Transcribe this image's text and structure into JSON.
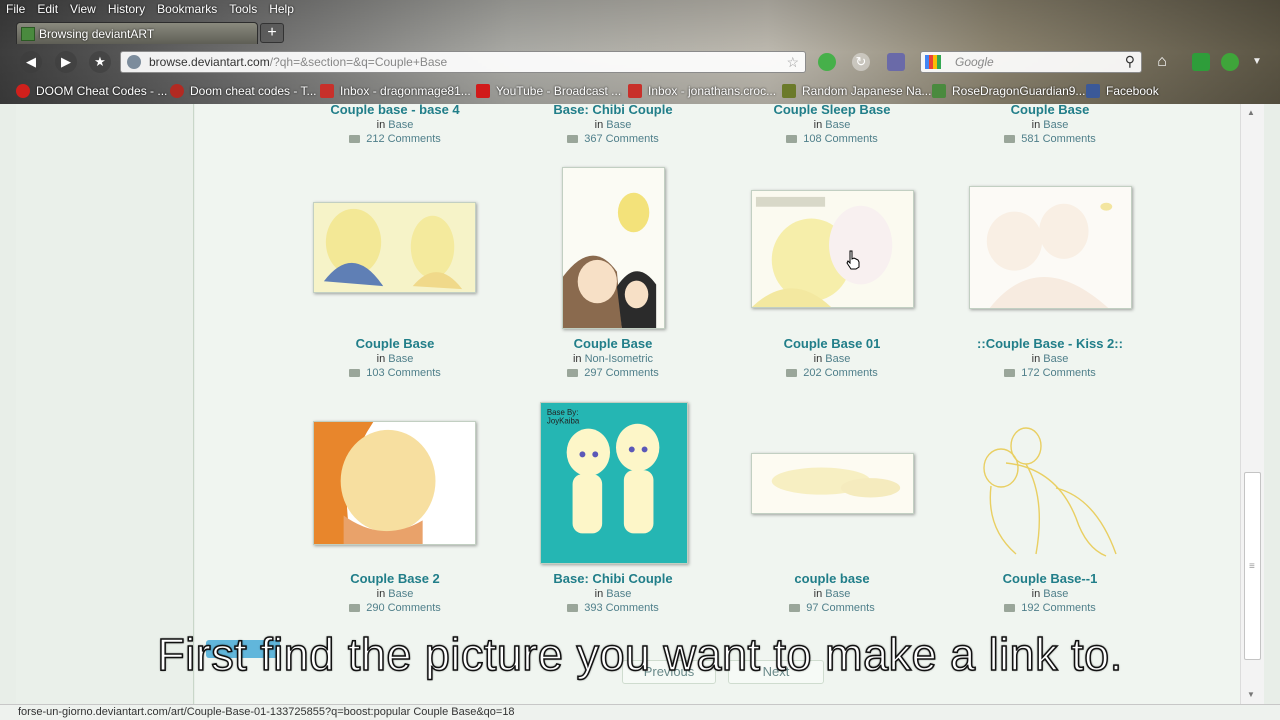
{
  "browser": {
    "menu": [
      "File",
      "Edit",
      "View",
      "History",
      "Bookmarks",
      "Tools",
      "Help"
    ],
    "tab_title": "Browsing deviantART",
    "new_tab": "+",
    "url_host": "browse.deviantart.com",
    "url_rest": "/?qh=&section=&q=Couple+Base",
    "search_placeholder": "Google",
    "bookmarks": [
      {
        "label": "DOOM Cheat Codes - ...",
        "color": "#d0201c"
      },
      {
        "label": "Doom cheat codes - T...",
        "color": "#b22a22"
      },
      {
        "label": "Inbox - dragonmage81...",
        "color": "#c8302a"
      },
      {
        "label": "YouTube - Broadcast ...",
        "color": "#d11a1a"
      },
      {
        "label": "Inbox - jonathans.croc...",
        "color": "#c8302a"
      },
      {
        "label": "Random Japanese Na...",
        "color": "#6b7a2a"
      },
      {
        "label": "RoseDragonGuardian9...",
        "color": "#4a8a3e"
      },
      {
        "label": "Facebook",
        "color": "#3b5998"
      }
    ]
  },
  "top_row": [
    {
      "title": "Couple base - base 4",
      "category": "Base",
      "comments": "212 Comments"
    },
    {
      "title": "Base: Chibi Couple",
      "category": "Base",
      "comments": "367 Comments"
    },
    {
      "title": "Couple Sleep Base",
      "category": "Base",
      "comments": "108 Comments"
    },
    {
      "title": "Couple Base",
      "category": "Base",
      "comments": "581 Comments"
    }
  ],
  "row2": [
    {
      "title": "Couple Base",
      "category": "Base",
      "comments": "103 Comments"
    },
    {
      "title": "Couple Base",
      "category": "Non-Isometric",
      "comments": "297 Comments"
    },
    {
      "title": "Couple Base 01",
      "category": "Base",
      "comments": "202 Comments"
    },
    {
      "title": "::Couple Base - Kiss 2::",
      "category": "Base",
      "comments": "172 Comments"
    }
  ],
  "row3": [
    {
      "title": "Couple Base 2",
      "category": "Base",
      "comments": "290 Comments"
    },
    {
      "title": "Base: Chibi Couple",
      "category": "Base",
      "comments": "393 Comments"
    },
    {
      "title": "couple base",
      "category": "Base",
      "comments": "97 Comments"
    },
    {
      "title": "Couple Base--1",
      "category": "Base",
      "comments": "192 Comments"
    }
  ],
  "in_word": "in",
  "thumb_text": {
    "chibi_watermark": "Base By:\nJoyKaiba"
  },
  "pager": {
    "previous": "Previous",
    "next": "Next"
  },
  "caption": "First find the picture you want to make a link to.",
  "status_url": "forse-un-giorno.deviantart.com/art/Couple-Base-01-133725855?q=boost:popular Couple Base&qo=18",
  "colors": {
    "link": "#217e89",
    "page_bg": "#f0f5f0"
  }
}
